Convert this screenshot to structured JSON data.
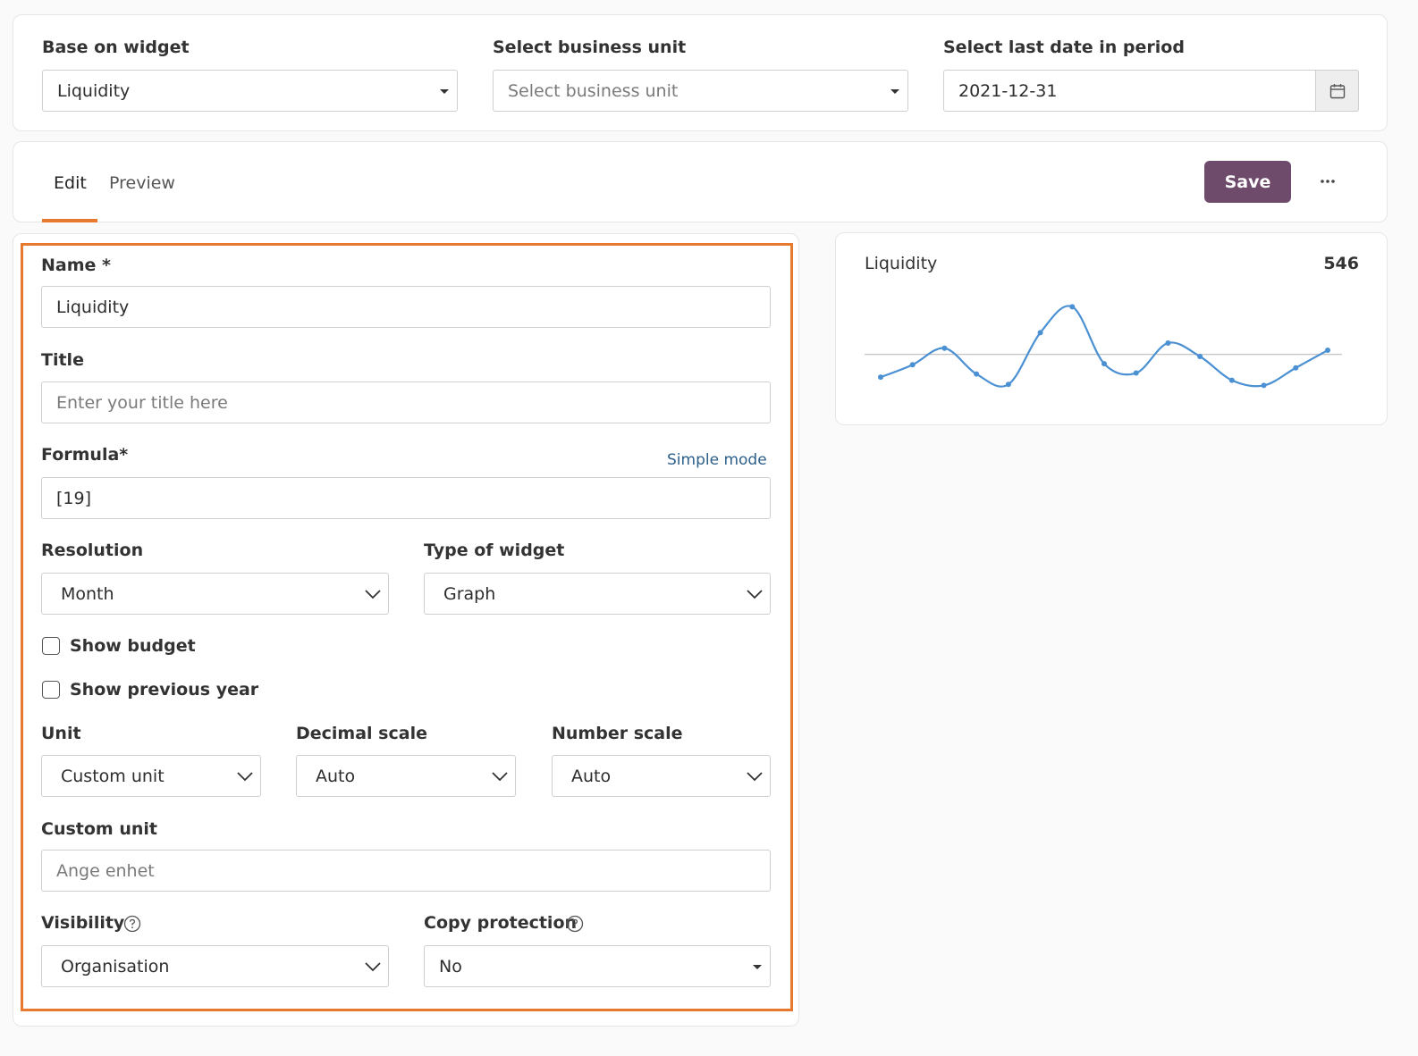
{
  "filters": {
    "base_widget": {
      "label": "Base on widget",
      "value": "Liquidity"
    },
    "business_unit": {
      "label": "Select business unit",
      "placeholder": "Select business unit"
    },
    "last_date": {
      "label": "Select last date in period",
      "value": "2021-12-31"
    }
  },
  "tabs": [
    {
      "label": "Edit",
      "active": true
    },
    {
      "label": "Preview",
      "active": false
    }
  ],
  "toolbar": {
    "save_label": "Save",
    "more_label": "···"
  },
  "form": {
    "name": {
      "label": "Name *",
      "value": "Liquidity"
    },
    "title": {
      "label": "Title",
      "placeholder": "Enter your title here"
    },
    "formula": {
      "label": "Formula*",
      "link": "Simple mode",
      "value": "[19]"
    },
    "resolution": {
      "label": "Resolution",
      "value": "Month"
    },
    "widget_type": {
      "label": "Type of widget",
      "value": "Graph"
    },
    "show_budget": {
      "label": "Show budget",
      "checked": false
    },
    "show_previous_year": {
      "label": "Show previous year",
      "checked": false
    },
    "unit": {
      "label": "Unit",
      "value": "Custom unit"
    },
    "decimal_scale": {
      "label": "Decimal scale",
      "value": "Auto"
    },
    "number_scale": {
      "label": "Number scale",
      "value": "Auto"
    },
    "custom_unit": {
      "label": "Custom unit",
      "placeholder": "Ange enhet"
    },
    "visibility": {
      "label": "Visibility",
      "value": "Organisation"
    },
    "copy_protection": {
      "label": "Copy protection",
      "value": "No"
    }
  },
  "preview": {
    "title": "Liquidity",
    "value": "546"
  },
  "colors": {
    "accent": "#e87a2f",
    "save_button": "#6e4b6b",
    "line": "#4a90d2",
    "link": "#2c5f8a"
  },
  "chart_data": {
    "type": "line",
    "title": "",
    "xlabel": "",
    "ylabel": "",
    "x": [
      1,
      2,
      3,
      4,
      5,
      6,
      7,
      8,
      9,
      10,
      11,
      12,
      13,
      14,
      15
    ],
    "series": [
      {
        "values": [
          -22,
          -10,
          6,
          -19,
          -29,
          21,
          46,
          -9,
          -18,
          11,
          -2,
          -25,
          -30,
          -13,
          4
        ]
      }
    ],
    "baseline": 0,
    "ylim": [
      -40,
      55
    ],
    "grid": false,
    "axes_visible": false
  }
}
